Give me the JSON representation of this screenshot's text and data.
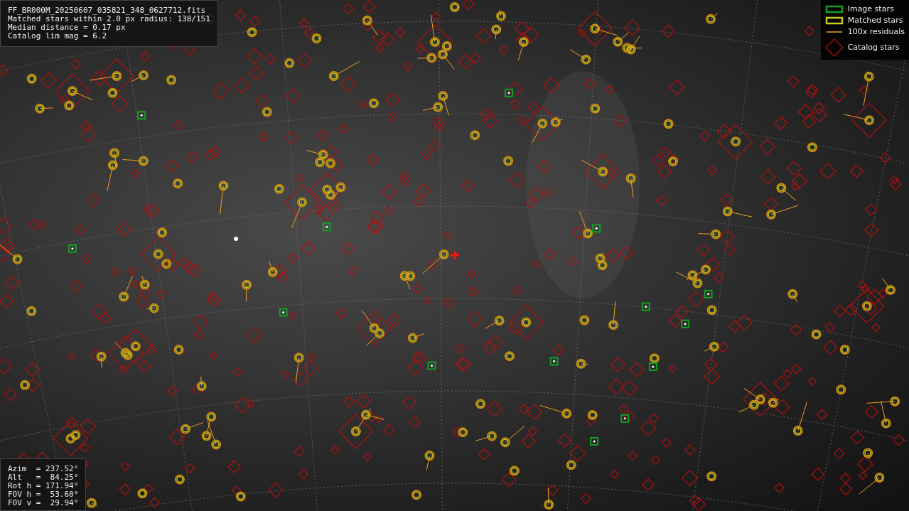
{
  "info_panel": {
    "lines": [
      "FF_BR000M_20250607_035821_348_0627712.fits",
      "Matched stars within 2.0 px radius: 138/151",
      "Median distance = 0.17 px",
      "Catalog lim mag = 6.2"
    ]
  },
  "pointing_panel": {
    "lines": [
      "Azim  = 237.52°",
      "Alt   =  84.25°",
      "Rot h = 171.94°",
      "FOV h =  53.60°",
      "FOV v =  29.94°"
    ]
  },
  "legend": [
    {
      "kind": "image",
      "label": "Image stars"
    },
    {
      "kind": "matched",
      "label": "Matched stars"
    },
    {
      "kind": "residual",
      "label": "100x residuals"
    },
    {
      "kind": "catalog",
      "label": "Catalog stars"
    }
  ]
}
